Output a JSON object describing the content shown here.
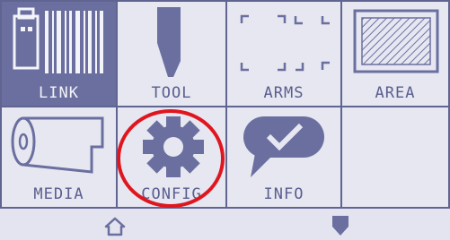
{
  "tiles": {
    "link": {
      "label": "LINK",
      "icon": "usb-barcode-icon"
    },
    "tool": {
      "label": "TOOL",
      "icon": "blade-tool-icon"
    },
    "arms": {
      "label": "ARMS",
      "icon": "corner-marks-icon"
    },
    "area": {
      "label": "AREA",
      "icon": "hatched-area-icon"
    },
    "media": {
      "label": "MEDIA",
      "icon": "media-roll-icon"
    },
    "config": {
      "label": "CONFIG",
      "icon": "gear-icon"
    },
    "info": {
      "label": "INFO",
      "icon": "speech-bubble-check-icon"
    }
  },
  "bottom_bar": {
    "home_icon": "home-icon",
    "scroll_icon": "down-arrow-icon"
  },
  "colors": {
    "screen_bg": "#e3e4ef",
    "tile_border": "#5f6491",
    "selected_bg": "#6b6f9f",
    "icon": "#6b6f9f",
    "highlight": "#e0161f"
  }
}
